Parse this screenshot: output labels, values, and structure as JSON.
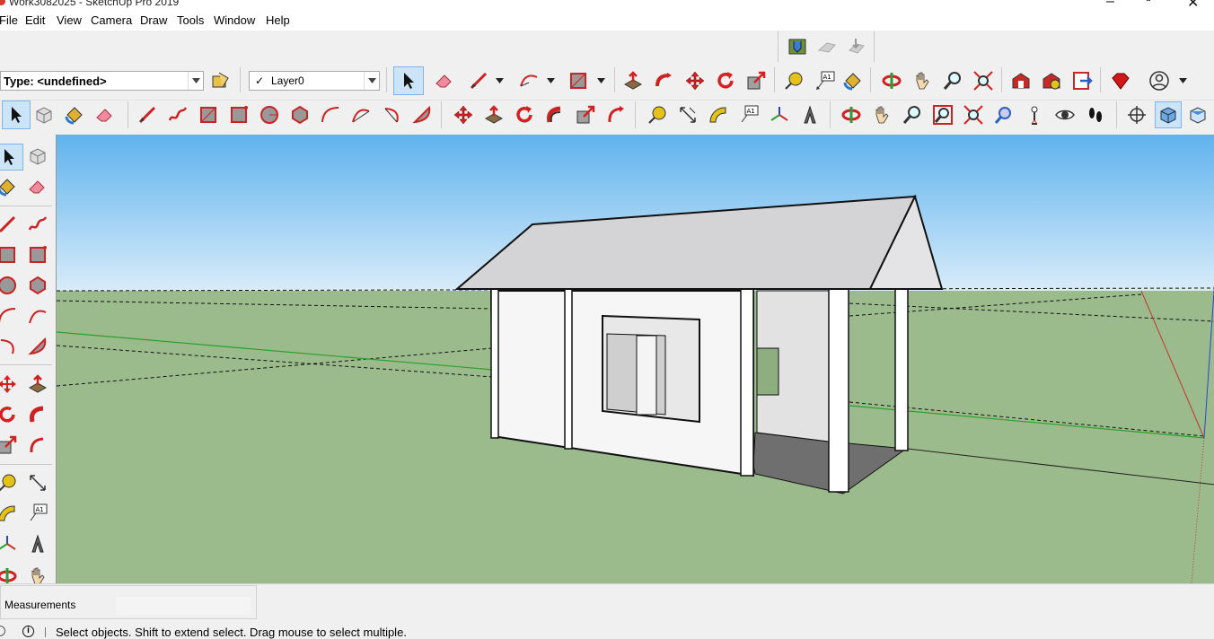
{
  "window": {
    "title": "Work3082025 - SketchUp Pro 2019",
    "controls": [
      "minimize-icon",
      "maximize-icon",
      "close-icon"
    ]
  },
  "menu": {
    "items": [
      "File",
      "Edit",
      "View",
      "Camera",
      "Draw",
      "Tools",
      "Window",
      "Help"
    ]
  },
  "toolbar": {
    "type_combo": {
      "value": "Type: <undefined>"
    },
    "layer_combo": {
      "value": "Layer0",
      "check": "✓"
    },
    "row0_icons": [
      "warehouse-search-icon",
      "upload-model-icon",
      "download-component-icon"
    ],
    "row1_icons": [
      "select-icon",
      "eraser-icon",
      "line-icon",
      "arc-icon",
      "rectangle-icon",
      "push-pull-icon",
      "follow-me-icon",
      "move-icon",
      "rotate-icon",
      "scale-icon",
      "tape-measure-icon",
      "text-icon",
      "paint-bucket-icon",
      "orbit-icon",
      "pan-icon",
      "zoom-icon",
      "zoom-extents-icon",
      "warehouse-icon",
      "extension-warehouse-icon",
      "layout-icon",
      "ruby-icon",
      "account-icon"
    ],
    "row2_icons": [
      "select-icon",
      "make-component-icon",
      "paint-bucket-icon",
      "eraser-icon",
      "line-icon",
      "freehand-icon",
      "rectangle-icon",
      "rotated-rectangle-icon",
      "circle-icon",
      "polygon-icon",
      "arc-icon",
      "two-point-arc-icon",
      "three-point-arc-icon",
      "pie-icon",
      "move-icon",
      "push-pull-icon",
      "rotate-icon",
      "follow-me-icon",
      "scale-icon",
      "offset-icon",
      "tape-measure-icon",
      "dimension-icon",
      "protractor-icon",
      "text-icon",
      "axes-icon",
      "3d-text-icon",
      "orbit-icon",
      "pan-icon",
      "zoom-icon",
      "zoom-window-icon",
      "zoom-extents-icon",
      "previous-view-icon",
      "position-camera-icon",
      "look-around-icon",
      "walk-icon",
      "section-plane-icon",
      "iso-view-icon",
      "top-view-icon"
    ]
  },
  "measurements": {
    "label": "Measurements",
    "value": ""
  },
  "status": {
    "text": "Select objects. Shift to extend select. Drag mouse to select multiple.",
    "icons": [
      "geolocation-icon",
      "info-icon"
    ]
  },
  "scene": {
    "sky_top": "#5fb3ee",
    "sky_bottom": "#d9ecf9",
    "ground": "#9cbb8d",
    "roof": "#d4d4d6",
    "wall": "#f6f6f6",
    "floor": "#6f6f6f",
    "axis_green": "#2ca02c",
    "axis_red": "#c0392b",
    "axis_blue": "#2846c8"
  }
}
